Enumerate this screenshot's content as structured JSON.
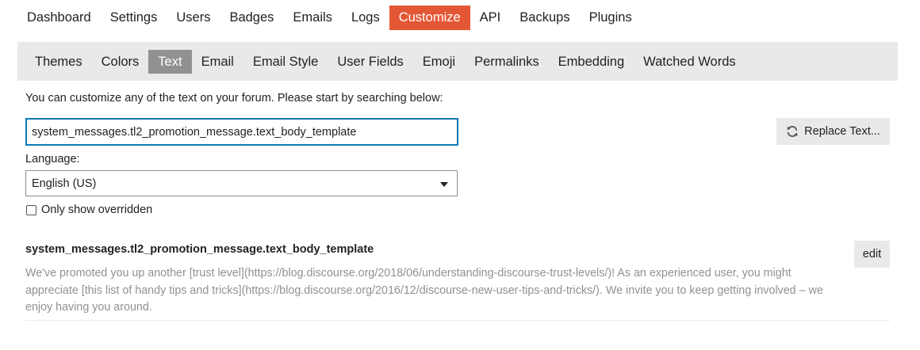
{
  "top_nav": {
    "items": [
      {
        "label": "Dashboard"
      },
      {
        "label": "Settings"
      },
      {
        "label": "Users"
      },
      {
        "label": "Badges"
      },
      {
        "label": "Emails"
      },
      {
        "label": "Logs"
      },
      {
        "label": "Customize",
        "active": true
      },
      {
        "label": "API"
      },
      {
        "label": "Backups"
      },
      {
        "label": "Plugins"
      }
    ]
  },
  "sub_nav": {
    "items": [
      {
        "label": "Themes"
      },
      {
        "label": "Colors"
      },
      {
        "label": "Text",
        "active": true
      },
      {
        "label": "Email"
      },
      {
        "label": "Email Style"
      },
      {
        "label": "User Fields"
      },
      {
        "label": "Emoji"
      },
      {
        "label": "Permalinks"
      },
      {
        "label": "Embedding"
      },
      {
        "label": "Watched Words"
      }
    ]
  },
  "search": {
    "intro": "You can customize any of the text on your forum. Please start by searching below:",
    "value": "system_messages.tl2_promotion_message.text_body_template"
  },
  "replace_button": {
    "label": "Replace Text...",
    "icon": "refresh-icon"
  },
  "language": {
    "label": "Language:",
    "selected": "English (US)"
  },
  "override_filter": {
    "label": "Only show overridden",
    "checked": false
  },
  "result": {
    "key": "system_messages.tl2_promotion_message.text_body_template",
    "value": "We've promoted you up another [trust level](https://blog.discourse.org/2018/06/understanding-discourse-trust-levels/)! As an experienced user, you might appreciate [this list of handy tips and tricks](https://blog.discourse.org/2016/12/discourse-new-user-tips-and-tricks/). We invite you to keep getting involved – we enjoy having you around.",
    "edit_label": "edit"
  },
  "colors": {
    "accent": "#e45735",
    "active_tab": "#919191",
    "focus_border": "#0e7ab5",
    "muted_text": "#919191",
    "panel_bg": "#e9e9e9"
  }
}
